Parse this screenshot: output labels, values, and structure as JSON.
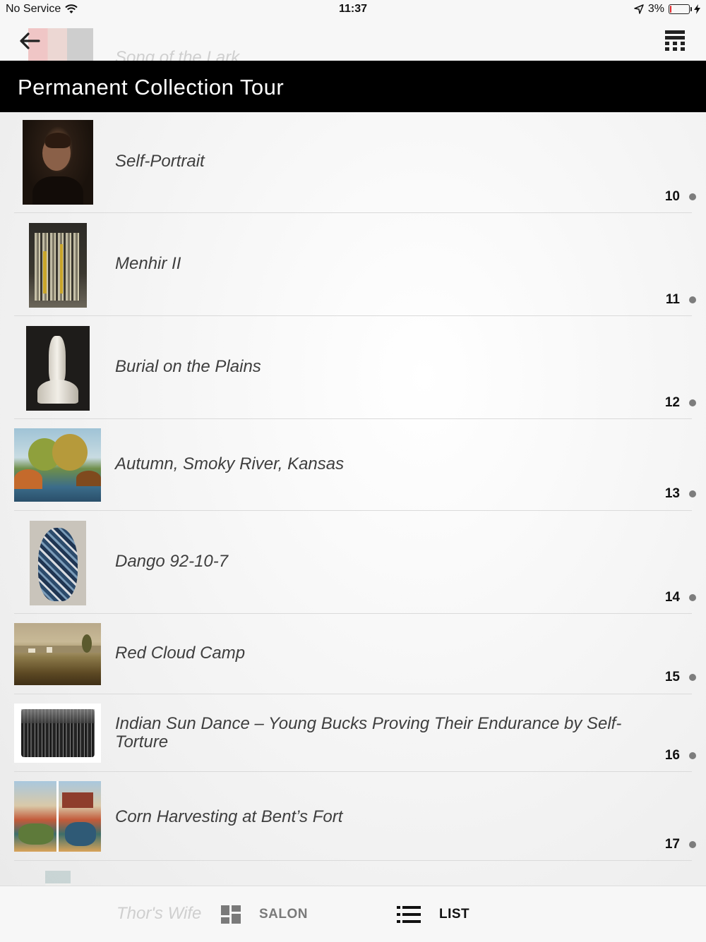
{
  "status_bar": {
    "carrier": "No Service",
    "time": "11:37",
    "battery_percent_label": "3%",
    "battery_level": 0.03
  },
  "nav": {
    "ghost_title": "Song of the Lark",
    "back_icon": "back-arrow-icon",
    "keypad_icon": "keypad-icon"
  },
  "header": {
    "title": "Permanent Collection Tour"
  },
  "list": {
    "items": [
      {
        "title": "Self-Portrait",
        "number": "10"
      },
      {
        "title": "Menhir II",
        "number": "11"
      },
      {
        "title": "Burial on the Plains",
        "number": "12"
      },
      {
        "title": "Autumn, Smoky River, Kansas",
        "number": "13"
      },
      {
        "title": "Dango 92-10-7",
        "number": "14"
      },
      {
        "title": "Red Cloud Camp",
        "number": "15"
      },
      {
        "title": "Indian Sun Dance – Young Bucks Proving Their Endurance by Self-Torture",
        "number": "16"
      },
      {
        "title": "Corn Harvesting at Bent’s Fort",
        "number": "17"
      }
    ],
    "ghost_next_title": "Thor's Wife"
  },
  "tabbar": {
    "salon_label": "SALON",
    "list_label": "LIST"
  },
  "colors": {
    "header_bg": "#000000",
    "dot": "#7d7d7d",
    "battery_low": "#e0272b"
  }
}
